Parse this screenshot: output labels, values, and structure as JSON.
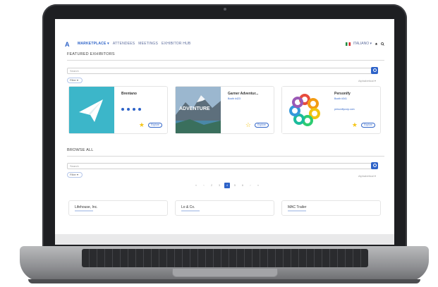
{
  "nav": {
    "items": [
      {
        "label": "MARKETPLACE",
        "active": true
      },
      {
        "label": "ATTENDEES",
        "active": false
      },
      {
        "label": "MEETINGS",
        "active": false
      },
      {
        "label": "EXHIBITOR HUB",
        "active": false
      }
    ],
    "language": "ITALIANO"
  },
  "featured": {
    "title": "FEATURED EXHIBITORS",
    "search_placeholder": "Search",
    "filter_label": "Filter",
    "sort_label": "Alphabetical",
    "cards": [
      {
        "name": "Brentano",
        "booth": "",
        "link": "",
        "starred": true,
        "explore_label": "Explore"
      },
      {
        "name": "Garner Adventur...",
        "booth": "Booth #423",
        "link": "",
        "starred": false,
        "explore_label": "Explore",
        "image_text": "ADVENTURE"
      },
      {
        "name": "Personify",
        "booth": "Booth #341",
        "link": "personifycorp.com",
        "starred": true,
        "explore_label": "Explore"
      }
    ]
  },
  "browse": {
    "title": "BROWSE ALL",
    "search_placeholder": "Search",
    "filter_label": "Filter",
    "sort_label": "Alphabetical",
    "pages": [
      "«",
      "‹",
      "2",
      "3",
      "4",
      "5",
      "6",
      "›",
      "»"
    ],
    "active_page": "4",
    "cards": [
      {
        "name": "Lifehouse, Inc."
      },
      {
        "name": "Lo & Co."
      },
      {
        "name": "MAC Trailer"
      }
    ]
  },
  "colors": {
    "accent": "#2e63c8",
    "star": "#f5c518",
    "brentano_bg": "#3cb6c9"
  }
}
